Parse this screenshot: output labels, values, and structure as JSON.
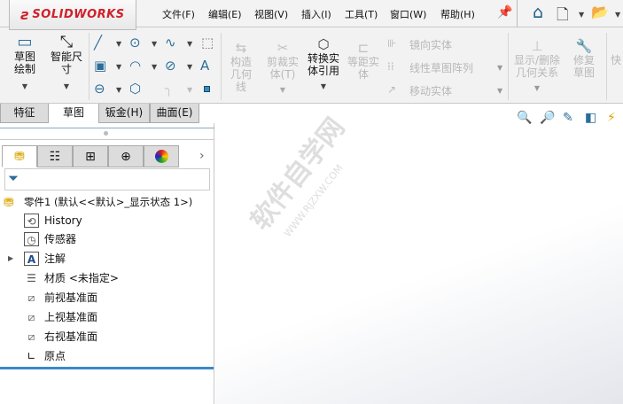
{
  "app": {
    "logo": "SOLIDWORKS"
  },
  "menu": [
    "文件(F)",
    "编辑(E)",
    "视图(V)",
    "插入(I)",
    "工具(T)",
    "窗口(W)",
    "帮助(H)"
  ],
  "toolbar": {
    "sketch": "草图绘制",
    "smart_dim": "智能尺寸",
    "construction": "构造几何线",
    "trim": "剪裁实体(T)",
    "convert": "转换实体引用",
    "offset": "等距实体",
    "mirror": "镜向实体",
    "linear_pattern": "线性草图阵列",
    "move": "移动实体",
    "relations": "显示/删除几何关系",
    "repair": "修复草图",
    "quick": "快"
  },
  "tabs": [
    "特征",
    "草图",
    "钣金(H)",
    "曲面(E)"
  ],
  "tree": {
    "root": "零件1  (默认<<默认>_显示状态 1>)",
    "items": [
      "History",
      "传感器",
      "注解",
      "材质 <未指定>",
      "前视基准面",
      "上视基准面",
      "右视基准面",
      "原点"
    ]
  },
  "watermark": {
    "text": "软件自学网",
    "url": "WWW.RJZXW.COM"
  }
}
